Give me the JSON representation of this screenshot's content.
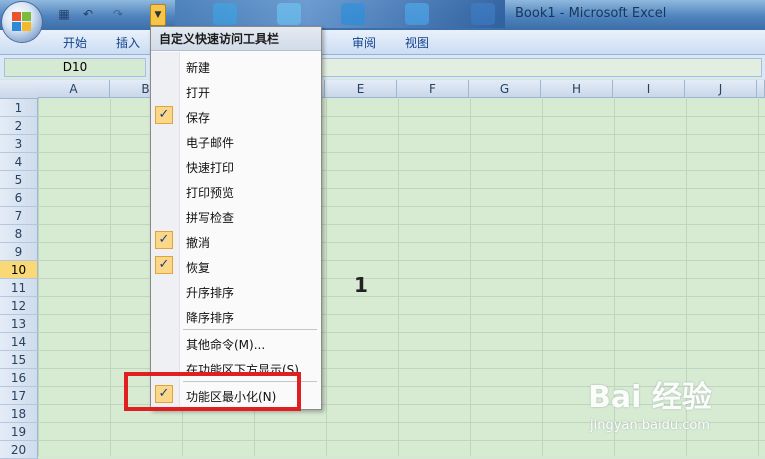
{
  "window": {
    "title": "Book1 - Microsoft Excel"
  },
  "ribbon": {
    "tabs": [
      "开始",
      "插入",
      "审阅",
      "视图"
    ]
  },
  "formula_bar": {
    "name_box": "D10",
    "content": ""
  },
  "grid": {
    "columns": [
      "A",
      "B",
      "E",
      "F",
      "G",
      "H",
      "I",
      "J"
    ],
    "rows": [
      "1",
      "2",
      "3",
      "4",
      "5",
      "6",
      "7",
      "8",
      "9",
      "10",
      "11",
      "12",
      "13",
      "14",
      "15",
      "16",
      "17",
      "18",
      "19",
      "20"
    ],
    "active_row": "10",
    "cell_fragment": "1"
  },
  "qat_menu": {
    "header": "自定义快速访问工具栏",
    "items": [
      {
        "label": "新建",
        "checked": false
      },
      {
        "label": "打开",
        "checked": false
      },
      {
        "label": "保存",
        "checked": true
      },
      {
        "label": "电子邮件",
        "checked": false
      },
      {
        "label": "快速打印",
        "checked": false
      },
      {
        "label": "打印预览",
        "checked": false
      },
      {
        "label": "拼写检查",
        "checked": false
      },
      {
        "label": "撤消",
        "checked": true
      },
      {
        "label": "恢复",
        "checked": true
      },
      {
        "label": "升序排序",
        "checked": false
      },
      {
        "label": "降序排序",
        "checked": false
      },
      {
        "label": "其他命令(M)...",
        "checked": false
      },
      {
        "label": "在功能区下方显示(S)",
        "checked": false
      },
      {
        "label": "功能区最小化(N)",
        "checked": true
      }
    ],
    "check_glyph": "✓"
  },
  "watermark": {
    "brand": "Bai 经验",
    "url": "jingyan.baidu.com"
  },
  "icons": {
    "save": "save-icon",
    "undo": "undo-icon",
    "redo": "redo-icon",
    "dropdown": "chevron-down-icon"
  },
  "colors": {
    "highlight": "#e02020",
    "check_bg": "#fbd78a"
  }
}
